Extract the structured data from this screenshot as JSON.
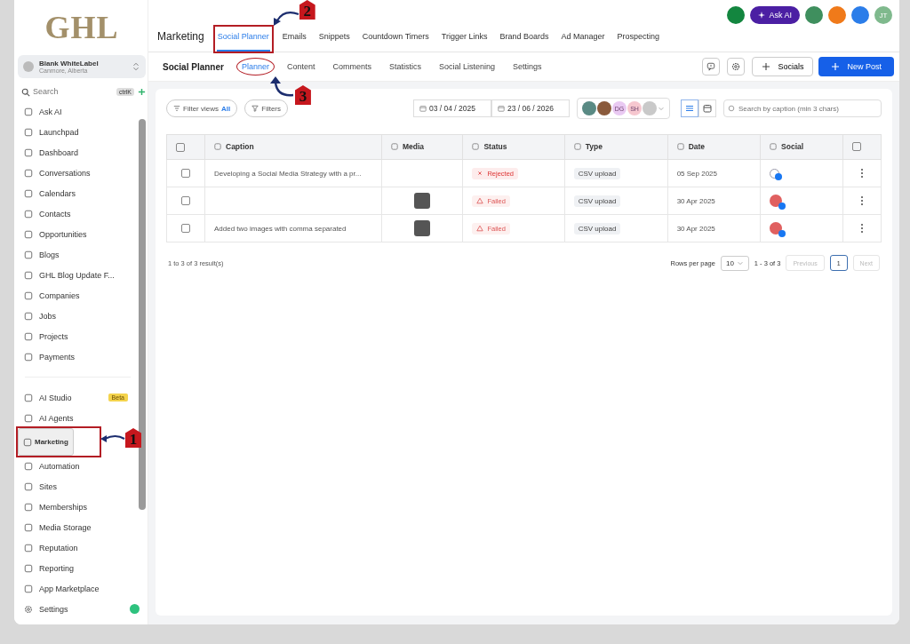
{
  "logo": "GHL",
  "account": {
    "name": "Blank WhiteLabel",
    "location": "Canmore, Alberta"
  },
  "search": {
    "placeholder": "Search",
    "shortcut": "ctrlK"
  },
  "sidebar": {
    "groups": [
      [
        {
          "label": "Ask AI",
          "selected": false
        },
        {
          "label": "Launchpad",
          "selected": false
        },
        {
          "label": "Dashboard",
          "selected": false
        },
        {
          "label": "Conversations",
          "selected": false
        },
        {
          "label": "Calendars",
          "selected": false
        },
        {
          "label": "Contacts",
          "selected": false
        },
        {
          "label": "Opportunities",
          "selected": false
        },
        {
          "label": "Blogs",
          "selected": false
        },
        {
          "label": "GHL Blog Update F...",
          "selected": false
        },
        {
          "label": "Companies",
          "selected": false
        },
        {
          "label": "Jobs",
          "selected": false
        },
        {
          "label": "Projects",
          "selected": false
        },
        {
          "label": "Payments",
          "selected": false
        }
      ],
      [
        {
          "label": "AI Studio",
          "selected": false,
          "badge": "Beta"
        },
        {
          "label": "AI Agents",
          "selected": false
        },
        {
          "label": "Marketing",
          "selected": true,
          "callout": {
            "number": "1",
            "kind": "box"
          }
        },
        {
          "label": "Automation",
          "selected": false
        },
        {
          "label": "Sites",
          "selected": false
        },
        {
          "label": "Memberships",
          "selected": false
        },
        {
          "label": "Media Storage",
          "selected": false
        },
        {
          "label": "Reputation",
          "selected": false
        },
        {
          "label": "Reporting",
          "selected": false
        },
        {
          "label": "App Marketplace",
          "selected": false
        }
      ]
    ],
    "settings": "Settings"
  },
  "header": {
    "title": "Marketing",
    "ask_ai": "Ask AI",
    "avatar": "JT",
    "tabs": [
      {
        "label": "Social Planner",
        "selected": true,
        "callout": {
          "number": "2",
          "kind": "box"
        }
      },
      {
        "label": "Emails",
        "selected": false
      },
      {
        "label": "Snippets",
        "selected": false
      },
      {
        "label": "Countdown Timers",
        "selected": false
      },
      {
        "label": "Trigger Links",
        "selected": false
      },
      {
        "label": "Brand Boards",
        "selected": false
      },
      {
        "label": "Ad Manager",
        "selected": false
      },
      {
        "label": "Prospecting",
        "selected": false
      }
    ]
  },
  "subnav": {
    "title": "Social Planner",
    "socials": "Socials",
    "new_post": "New Post",
    "tabs": [
      {
        "label": "Planner",
        "selected": true,
        "callout": {
          "number": "3",
          "kind": "ellipse"
        }
      },
      {
        "label": "Content",
        "selected": false
      },
      {
        "label": "Comments",
        "selected": false
      },
      {
        "label": "Statistics",
        "selected": false
      },
      {
        "label": "Social Listening",
        "selected": false
      },
      {
        "label": "Settings",
        "selected": false
      }
    ]
  },
  "toolbar": {
    "filter_views": {
      "label": "Filter views",
      "value": "All"
    },
    "filters": "Filters",
    "date_from": "03 / 04 / 2025",
    "date_to": "23 / 06 / 2026",
    "accounts": [
      {
        "kind": "photo",
        "color": "#5a8a84"
      },
      {
        "kind": "photo",
        "color": "#8a5a3c"
      },
      {
        "kind": "initials",
        "initials": "DG",
        "color": "#e9c9f2"
      },
      {
        "kind": "initials",
        "initials": "SH",
        "color": "#f6c7cf"
      },
      {
        "kind": "silhouette",
        "color": "#c9c9c9"
      }
    ],
    "views": [
      {
        "kind": "list",
        "selected": true
      },
      {
        "kind": "calendar",
        "selected": false
      }
    ],
    "search_placeholder": "Search by caption (min 3 chars)"
  },
  "table": {
    "all_checked": false,
    "columns": [
      "Caption",
      "Media",
      "Status",
      "Type",
      "Date",
      "Social"
    ],
    "rows": [
      {
        "checked": false,
        "caption": "Developing a Social Media Strategy with a pr...",
        "has_media": false,
        "status": {
          "kind": "rejected",
          "label": "Rejected"
        },
        "type": "CSV upload",
        "date": "05 Sep 2025",
        "social": {
          "kind": "person"
        }
      },
      {
        "checked": false,
        "has_media": true,
        "status": {
          "kind": "failed",
          "label": "Failed"
        },
        "type": "CSV upload",
        "date": "30 Apr 2025",
        "social": {
          "kind": "photo"
        }
      },
      {
        "checked": false,
        "caption": "Added two images with comma separated",
        "has_media": true,
        "status": {
          "kind": "failed",
          "label": "Failed"
        },
        "type": "CSV upload",
        "date": "30 Apr 2025",
        "social": {
          "kind": "photo"
        }
      }
    ]
  },
  "pagination": {
    "summary": "1 to 3 of 3 result(s)",
    "rows_per_page_label": "Rows per page",
    "rows_per_page": "10",
    "range": "1 - 3 of 3",
    "previous": "Previous",
    "page": "1",
    "next": "Next"
  }
}
